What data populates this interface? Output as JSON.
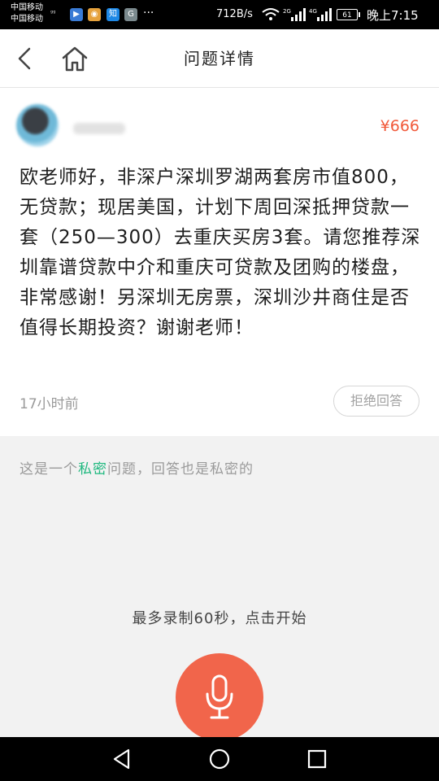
{
  "status_bar": {
    "carrier_1": "中国移动",
    "carrier_2": "中国移动",
    "tiny_label": "ᵍᵍ",
    "apps": [
      {
        "name": "video-app-icon",
        "color": "#3a7bd5",
        "glyph": "▶"
      },
      {
        "name": "weibo-app-icon",
        "color": "#e6a23c",
        "glyph": "◉"
      },
      {
        "name": "zhihu-app-icon",
        "color": "#1e88e5",
        "glyph": "知"
      },
      {
        "name": "sync-app-icon",
        "color": "#7b8a8e",
        "glyph": "G"
      }
    ],
    "more": "···",
    "net_speed": "712B/s",
    "battery": "61",
    "time": "晚上7:15"
  },
  "header": {
    "title": "问题详情"
  },
  "question": {
    "price": "¥666",
    "text": "欧老师好，非深户深圳罗湖两套房市值800，无贷款；现居美国，计划下周回深抵押贷款一套（250—300）去重庆买房3套。请您推荐深圳靠谱贷款中介和重庆可贷款及团购的楼盘，非常感谢！另深圳无房票，深圳沙井商住是否值得长期投资？谢谢老师！",
    "time_ago": "17小时前",
    "reject_label": "拒绝回答"
  },
  "notice": {
    "before": "这是一个",
    "highlight": "私密",
    "after": "问题，回答也是私密的"
  },
  "record": {
    "hint": "最多录制60秒，点击开始"
  },
  "colors": {
    "accent_red": "#f15a3b",
    "accent_green": "#1fb87f"
  }
}
